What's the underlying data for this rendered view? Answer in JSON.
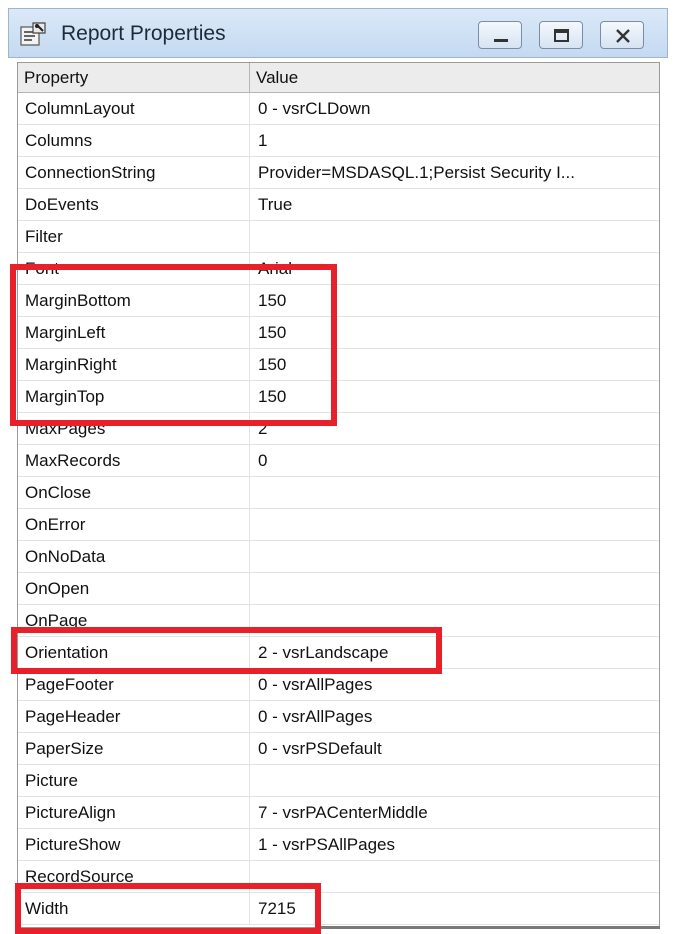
{
  "window": {
    "title": "Report Properties",
    "icon": "properties-icon",
    "controls": [
      "minimize-icon",
      "maximize-icon",
      "close-icon"
    ]
  },
  "grid": {
    "header": {
      "property": "Property",
      "value": "Value"
    },
    "rows": [
      {
        "property": "ColumnLayout",
        "value": "0 - vsrCLDown"
      },
      {
        "property": "Columns",
        "value": "1"
      },
      {
        "property": "ConnectionString",
        "value": "Provider=MSDASQL.1;Persist Security I..."
      },
      {
        "property": "DoEvents",
        "value": "True"
      },
      {
        "property": "Filter",
        "value": ""
      },
      {
        "property": "Font",
        "value": "Arial"
      },
      {
        "property": "MarginBottom",
        "value": "150"
      },
      {
        "property": "MarginLeft",
        "value": "150"
      },
      {
        "property": "MarginRight",
        "value": "150"
      },
      {
        "property": "MarginTop",
        "value": "150"
      },
      {
        "property": "MaxPages",
        "value": "2"
      },
      {
        "property": "MaxRecords",
        "value": "0"
      },
      {
        "property": "OnClose",
        "value": ""
      },
      {
        "property": "OnError",
        "value": ""
      },
      {
        "property": "OnNoData",
        "value": ""
      },
      {
        "property": "OnOpen",
        "value": ""
      },
      {
        "property": "OnPage",
        "value": ""
      },
      {
        "property": "Orientation",
        "value": "2 - vsrLandscape"
      },
      {
        "property": "PageFooter",
        "value": "0 - vsrAllPages"
      },
      {
        "property": "PageHeader",
        "value": "0 - vsrAllPages"
      },
      {
        "property": "PaperSize",
        "value": "0 - vsrPSDefault"
      },
      {
        "property": "Picture",
        "value": ""
      },
      {
        "property": "PictureAlign",
        "value": "7 - vsrPACenterMiddle"
      },
      {
        "property": "PictureShow",
        "value": "1 - vsrPSAllPages"
      },
      {
        "property": "RecordSource",
        "value": ""
      },
      {
        "property": "Width",
        "value": "7215"
      }
    ]
  },
  "annotations": {
    "highlight_color": "#e8202a",
    "highlighted": [
      "MarginBottom",
      "MarginLeft",
      "MarginRight",
      "MarginTop",
      "Orientation",
      "Width"
    ]
  }
}
